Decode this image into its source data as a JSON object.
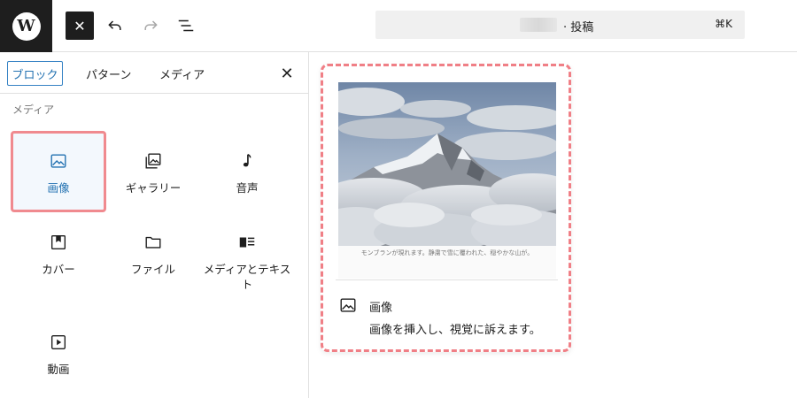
{
  "toolbar": {
    "logo_letter": "W",
    "close_symbol": "✕",
    "document_title": "· 投稿",
    "shortcut": "⌘K"
  },
  "inserter": {
    "tabs": [
      {
        "label": "ブロック",
        "active": true
      },
      {
        "label": "パターン",
        "active": false
      },
      {
        "label": "メディア",
        "active": false
      }
    ],
    "close_symbol": "✕",
    "category": "メディア",
    "blocks": [
      {
        "label": "画像",
        "icon": "image-icon",
        "selected": true
      },
      {
        "label": "ギャラリー",
        "icon": "gallery-icon",
        "selected": false
      },
      {
        "label": "音声",
        "icon": "audio-icon",
        "selected": false
      },
      {
        "label": "カバー",
        "icon": "cover-icon",
        "selected": false
      },
      {
        "label": "ファイル",
        "icon": "file-icon",
        "selected": false
      },
      {
        "label": "メディアとテキスト",
        "icon": "media-text-icon",
        "selected": false
      },
      {
        "label": "動画",
        "icon": "video-icon",
        "selected": false
      }
    ]
  },
  "preview": {
    "caption": "モンブランが現れます。静粛で雪に覆われた、穏やかな山が。",
    "title": "画像",
    "description": "画像を挿入し、視覚に訴えます。"
  },
  "colors": {
    "accent": "#2271b1",
    "highlight": "#f08a8f"
  }
}
